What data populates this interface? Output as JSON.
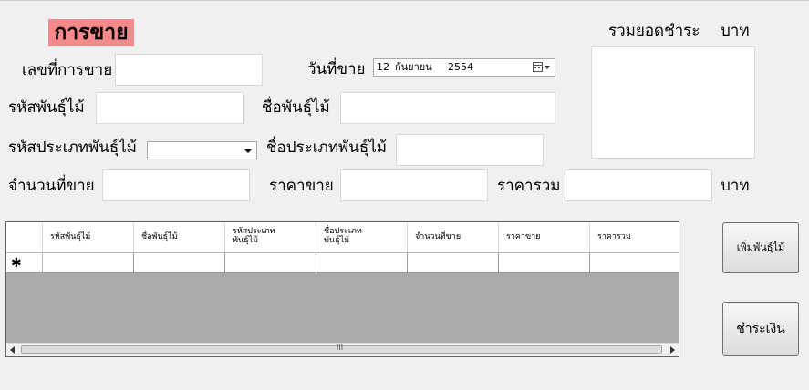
{
  "form": {
    "title": "การขาย",
    "sale_no_label": "เลขที่การขาย",
    "sale_date_label": "วันที่ขาย",
    "sale_date": {
      "day": "12",
      "month": "กันยายน",
      "year": "2554"
    },
    "plant_code_label": "รหัสพันธุ์ไม้",
    "plant_name_label": "ชื่อพันธุ์ไม้",
    "type_code_label": "รหัสประเภทพันธุ์ไม้",
    "type_name_label": "ชื่อประเภทพันธุ์ไม้",
    "qty_label": "จำนวนที่ขาย",
    "price_label": "ราคาขาย",
    "total_label": "ราคารวม",
    "baht_label": "บาท",
    "grand_total_label": "รวมยอดชำระ",
    "grand_total_unit": "บาท",
    "values": {
      "sale_no": "",
      "plant_code": "",
      "plant_name": "",
      "type_code": "",
      "type_name": "",
      "qty": "",
      "price": "",
      "total": "",
      "grand_total": ""
    }
  },
  "grid": {
    "columns": [
      "รหัสพันธุ์ไม้",
      "ชื่อพันธุ์ไม้",
      "รหัสประเภท\nพันธุ์ไม้",
      "ชื่อประเภท\nพันธุ์ไม้",
      "จำนวนที่ขาย",
      "ราคาขาย",
      "ราคารวม"
    ],
    "new_row_marker": "✱",
    "scroll_grip": "III"
  },
  "buttons": {
    "add_plant": "เพิ่มพันธุ์ไม้",
    "pay": "ชำระเงิน"
  }
}
